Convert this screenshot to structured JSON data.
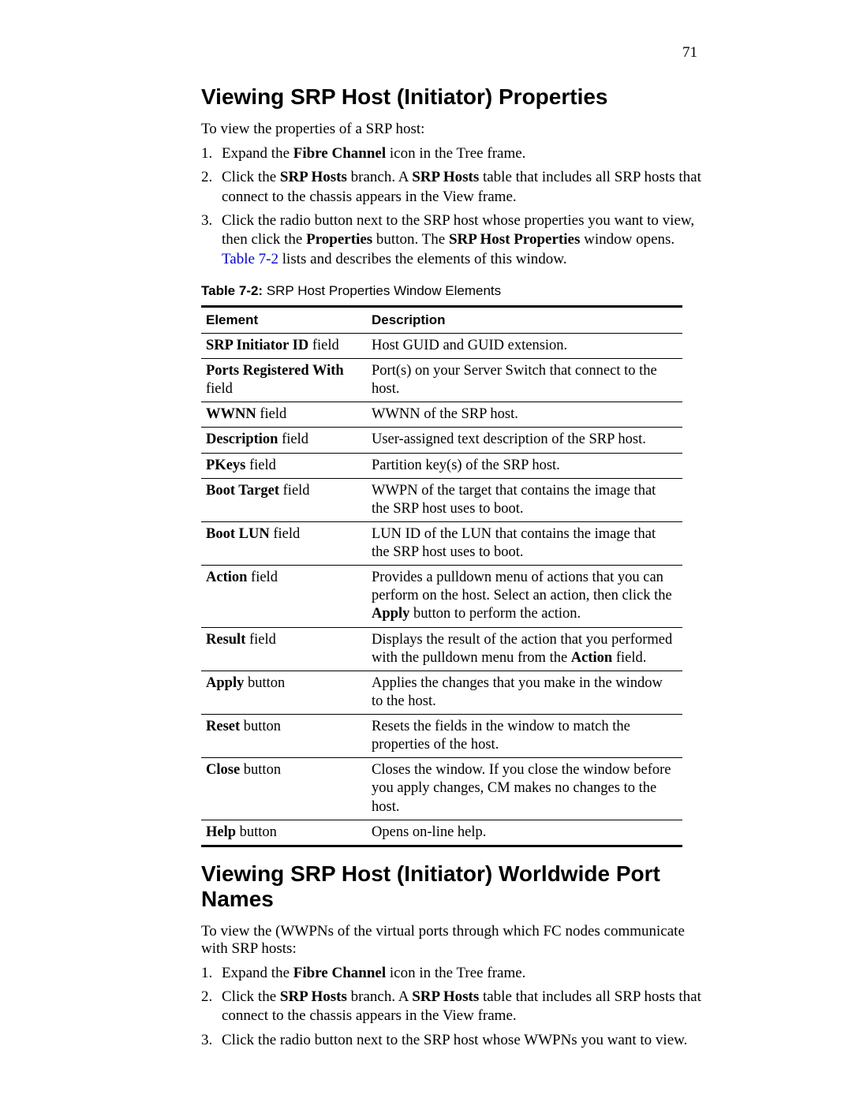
{
  "page_number": "71",
  "section1": {
    "heading": "Viewing SRP Host (Initiator) Properties",
    "intro": "To view the properties of a SRP host:",
    "steps": [
      {
        "pre": "Expand the ",
        "b1": "Fibre Channel",
        "post": " icon in the Tree frame."
      },
      {
        "pre": "Click the ",
        "b1": "SRP Hosts",
        "mid": " branch. A ",
        "b2": "SRP Hosts",
        "post": " table that includes all SRP hosts that connect to the chassis appears in the View frame."
      },
      {
        "pre": "Click the radio button next to the SRP host whose properties you want to view, then click the ",
        "b1": "Properties",
        "mid": " button. The ",
        "b2": "SRP Host Properties",
        "mid2": " window opens. ",
        "link": "Table 7-2",
        "post": " lists and describes the elements of this window."
      }
    ],
    "table": {
      "caption_label": "Table 7-2:",
      "caption_text": " SRP Host Properties Window Elements",
      "headers": [
        "Element",
        "Description"
      ],
      "rows": [
        {
          "e_b": "SRP Initiator ID",
          "e_t": " field",
          "d": "Host GUID and GUID extension."
        },
        {
          "e_b": "Ports Registered With",
          "e_t": " field",
          "d": "Port(s) on your Server Switch that connect to the host."
        },
        {
          "e_b": "WWNN",
          "e_t": " field",
          "d": "WWNN of the SRP host."
        },
        {
          "e_b": "Description",
          "e_t": " field",
          "d": "User-assigned text description of the SRP host."
        },
        {
          "e_b": "PKeys",
          "e_t": " field",
          "d": "Partition key(s) of the SRP host."
        },
        {
          "e_b": "Boot Target",
          "e_t": " field",
          "d": "WWPN of the target that contains the image that the SRP host uses to boot."
        },
        {
          "e_b": "Boot LUN",
          "e_t": " field",
          "d": "LUN ID of the LUN that contains the image that the SRP host uses to boot."
        },
        {
          "e_b": "Action",
          "e_t": " field",
          "d_pre": "Provides a pulldown menu of actions that you can perform on the host. Select an action, then click the ",
          "d_b": "Apply",
          "d_post": " button to perform the action."
        },
        {
          "e_b": "Result",
          "e_t": " field",
          "d_pre": "Displays the result of the action that you performed with the pulldown menu from the ",
          "d_b": "Action",
          "d_post": " field."
        },
        {
          "e_b": "Apply",
          "e_t": " button",
          "d": "Applies the changes that you make in the window to the host."
        },
        {
          "e_b": "Reset",
          "e_t": " button",
          "d": "Resets the fields in the window to match the properties of the host."
        },
        {
          "e_b": "Close",
          "e_t": " button",
          "d": "Closes the window. If you close the window before you apply changes, CM makes no changes to the host."
        },
        {
          "e_b": "Help",
          "e_t": " button",
          "d": "Opens on-line help."
        }
      ]
    }
  },
  "section2": {
    "heading": "Viewing SRP Host (Initiator) Worldwide Port Names",
    "intro": "To view the (WWPNs of the virtual ports through which FC nodes communicate with SRP hosts:",
    "steps": [
      {
        "pre": "Expand the ",
        "b1": "Fibre Channel",
        "post": " icon in the Tree frame."
      },
      {
        "pre": "Click the ",
        "b1": "SRP Hosts",
        "mid": " branch. A ",
        "b2": "SRP Hosts",
        "post": " table that includes all SRP hosts that connect to the chassis appears in the View frame."
      },
      {
        "pre": "Click the radio button next to the SRP host whose WWPNs you want to view."
      }
    ]
  }
}
